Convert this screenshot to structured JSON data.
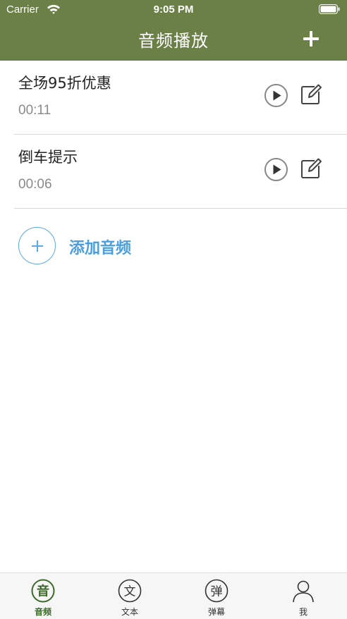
{
  "status_bar": {
    "carrier": "Carrier",
    "time": "9:05 PM"
  },
  "nav": {
    "title": "音频播放",
    "add_icon": "plus-icon"
  },
  "audio_list": [
    {
      "title": "全场95折优惠",
      "duration": "00:11"
    },
    {
      "title": "倒车提示",
      "duration": "00:06"
    }
  ],
  "add_audio": {
    "label": "添加音频"
  },
  "tabs": [
    {
      "label": "音频",
      "glyph": "音",
      "active": true
    },
    {
      "label": "文本",
      "glyph": "文",
      "active": false
    },
    {
      "label": "弹幕",
      "glyph": "弹",
      "active": false
    },
    {
      "label": "我",
      "glyph": "",
      "active": false
    }
  ],
  "colors": {
    "nav_bg": "#6b8046",
    "accent_blue": "#4a9fe0",
    "active_tab": "#3d6a2a"
  }
}
